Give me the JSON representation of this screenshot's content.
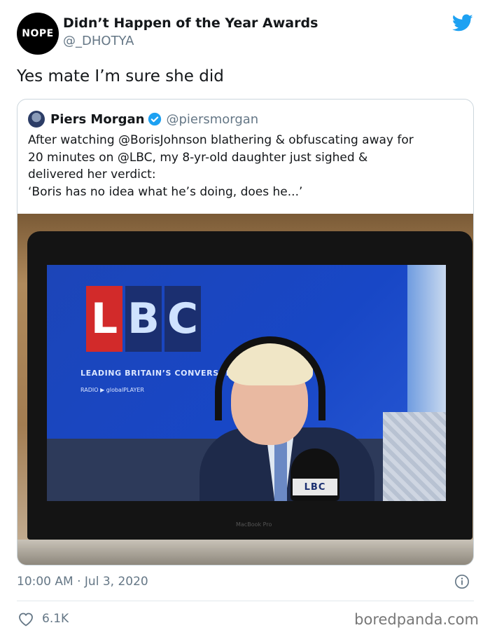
{
  "header": {
    "avatar_text": "NOPE",
    "name": "Didn’t Happen of the Year Awards",
    "handle": "@_DHOTYA",
    "platform_icon": "twitter-bird-icon",
    "accent_color": "#1da1f2"
  },
  "tweet": {
    "text": "Yes mate I’m sure she did"
  },
  "quoted": {
    "name": "Piers Morgan",
    "verified_icon": "verified-badge-icon",
    "handle": "@piersmorgan",
    "lines": [
      "After watching @BorisJohnson blathering & obfuscating away for",
      "20 minutes on @LBC, my 8-yr-old daughter just sighed &",
      "delivered her verdict:",
      "‘Boris has no idea what he’s doing, does he...’"
    ],
    "media": {
      "logo_letters": [
        "L",
        "B",
        "C"
      ],
      "tagline": "LEADING BRITAIN’S CONVERSATI",
      "sub_tagline": "RADIO   ▶ globalPLAYER",
      "mic_label": "LBC",
      "laptop_brand": "MacBook Pro"
    }
  },
  "meta": {
    "time": "10:00 AM · Jul 3, 2020",
    "info_icon": "info-icon"
  },
  "actions": {
    "like_icon": "heart-icon",
    "like_count": "6.1K"
  },
  "watermark": "boredpanda.com"
}
